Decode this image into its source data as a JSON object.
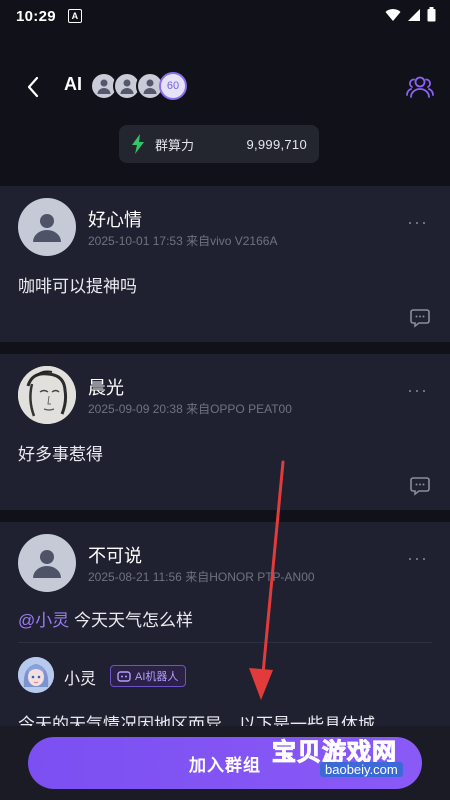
{
  "status_bar": {
    "time": "10:29",
    "notif_letter": "A"
  },
  "header": {
    "back_icon": "chevron-left-icon",
    "title": "AI",
    "member_count": "60",
    "members_icon": "group-members-icon"
  },
  "power": {
    "label": "群算力",
    "value": "9,999,710",
    "icon": "lightning-icon",
    "accent": "#35c46a"
  },
  "posts": [
    {
      "name": "好心情",
      "meta": "2025-10-01 17:53 来自vivo V2166A",
      "content": "咖啡可以提神吗",
      "more": "···"
    },
    {
      "name": "晨光",
      "meta": "2025-09-09 20:38 来自OPPO PEAT00",
      "content": "好多事惹得",
      "more": "···"
    },
    {
      "name": "不可说",
      "meta": "2025-08-21 11:56 来自HONOR PTP-AN00",
      "mention": "@小灵",
      "content": "今天天气怎么样",
      "more": "···",
      "reply": {
        "name": "小灵",
        "tag": "AI机器人",
        "text": "今天的天气情况因地区而异，以下是一些具体城"
      }
    }
  ],
  "bottom": {
    "join_label": "加入群组"
  },
  "watermark": {
    "text": "宝贝游戏网",
    "url": "baobeiy.com"
  },
  "colors": {
    "accent": "#7b4ff1",
    "background": "#111119",
    "card": "#1f2130",
    "arrow": "#e23b3b"
  }
}
